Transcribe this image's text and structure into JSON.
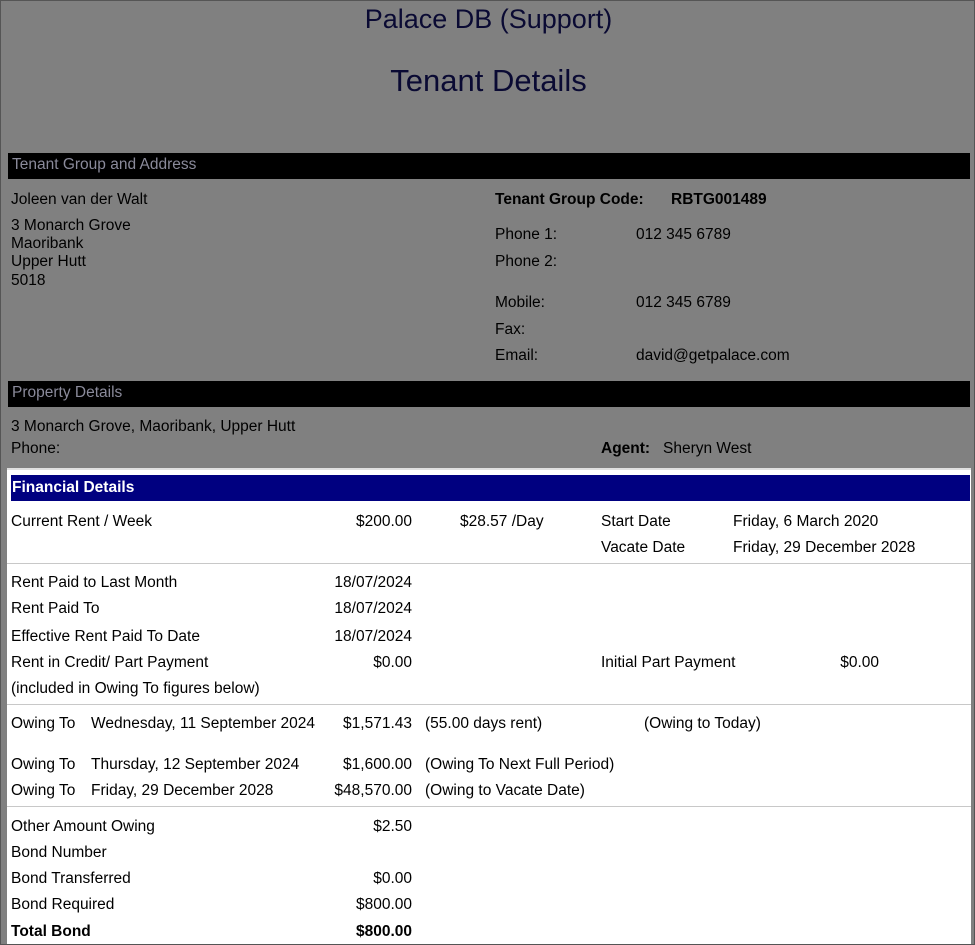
{
  "header": {
    "app_title": "Palace DB (Support)",
    "report_title": "Tenant Details"
  },
  "tenant_group": {
    "section_label": "Tenant Group and Address",
    "name": "Joleen van der Walt",
    "address": [
      "3 Monarch Grove",
      "Maoribank",
      "Upper Hutt",
      "5018"
    ],
    "code_label": "Tenant Group Code:",
    "code": "RBTG001489",
    "phone1_label": "Phone 1:",
    "phone1": "012 345 6789",
    "phone2_label": "Phone 2:",
    "phone2": "",
    "mobile_label": "Mobile:",
    "mobile": "012 345 6789",
    "fax_label": "Fax:",
    "fax": "",
    "email_label": "Email:",
    "email": "david@getpalace.com"
  },
  "property": {
    "section_label": "Property Details",
    "address": "3 Monarch Grove, Maoribank, Upper Hutt",
    "phone_label": "Phone:",
    "agent_label": "Agent:",
    "agent": "Sheryn West"
  },
  "financial": {
    "section_label": "Financial Details",
    "current_rent_label": "Current Rent / Week",
    "current_rent": "$200.00",
    "per_day": "$28.57 /Day",
    "start_date_label": "Start Date",
    "start_date": "Friday, 6 March 2020",
    "vacate_date_label": "Vacate Date",
    "vacate_date": "Friday, 29 December 2028",
    "rent_paid_last_month_label": "Rent Paid to Last Month",
    "rent_paid_last_month": "18/07/2024",
    "rent_paid_to_label": "Rent Paid To",
    "rent_paid_to": "18/07/2024",
    "effective_rent_label": "Effective Rent Paid To Date",
    "effective_rent": "18/07/2024",
    "rent_credit_label": "Rent in Credit/ Part Payment",
    "rent_credit": "$0.00",
    "rent_credit_note": "(included in Owing To figures below)",
    "initial_part_label": "Initial Part Payment",
    "initial_part": "$0.00",
    "owing_rows": [
      {
        "label": "Owing To",
        "date": "Wednesday, 11 September 2024",
        "amount": "$1,571.43",
        "note": "(55.00 days rent)",
        "extra": "(Owing to Today)"
      },
      {
        "label": "Owing To",
        "date": "Thursday, 12 September 2024",
        "amount": "$1,600.00",
        "note": "(Owing To Next Full Period)",
        "extra": ""
      },
      {
        "label": "Owing To",
        "date": "Friday, 29 December 2028",
        "amount": "$48,570.00",
        "note": "(Owing to Vacate Date)",
        "extra": ""
      }
    ],
    "other_owing_label": "Other Amount Owing",
    "other_owing": "$2.50",
    "bond_number_label": "Bond Number",
    "bond_number": "",
    "bond_transferred_label": "Bond Transferred",
    "bond_transferred": "$0.00",
    "bond_required_label": "Bond Required",
    "bond_required": "$800.00",
    "total_bond_label": "Total Bond",
    "total_bond": "$800.00"
  }
}
